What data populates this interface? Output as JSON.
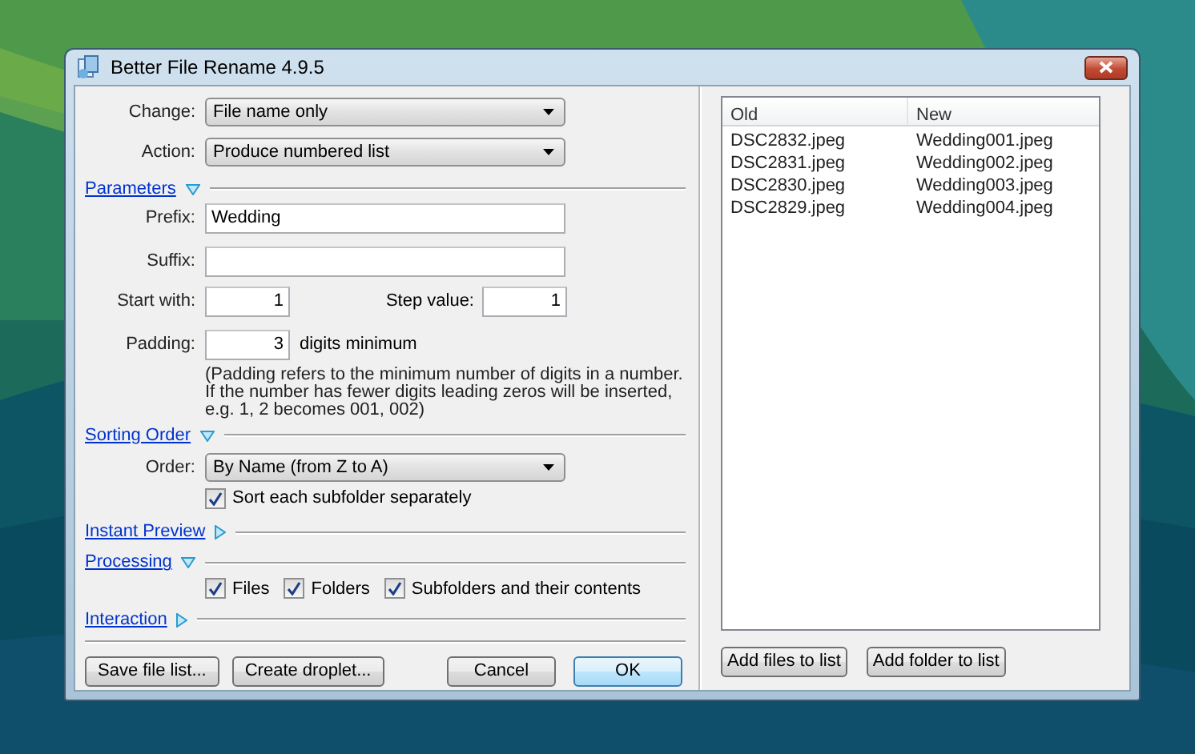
{
  "window": {
    "title": "Better File Rename 4.9.5"
  },
  "top_fields": [
    {
      "label": "Change:",
      "value": "File name only"
    },
    {
      "label": "Action:",
      "value": "Produce numbered list"
    }
  ],
  "sections": [
    {
      "kind": "parameters",
      "title": "Parameters",
      "expanded": true,
      "prefix": {
        "label": "Prefix:",
        "value": "Wedding"
      },
      "suffix": {
        "label": "Suffix:"
      },
      "start_with": {
        "label": "Start with:",
        "value": "1"
      },
      "step_value": {
        "label": "Step value:",
        "value": "1"
      },
      "padding": {
        "label": "Padding:",
        "value": "3",
        "unit": "digits minimum"
      },
      "note": "(Padding refers to the minimum number of digits in a number.\nIf the number has fewer digits leading zeros will be inserted,\ne.g. 1, 2 becomes 001, 002)"
    },
    {
      "kind": "sorting",
      "title": "Sorting Order",
      "expanded": true,
      "order": {
        "label": "Order:",
        "value": "By Name (from Z to A)"
      },
      "checkbox": {
        "label": "Sort each subfolder separately",
        "checked": true
      }
    },
    {
      "kind": "empty",
      "title": "Instant Preview",
      "expanded": false
    },
    {
      "kind": "processing",
      "title": "Processing",
      "expanded": true,
      "checkboxes": [
        {
          "label": "Files",
          "checked": true
        },
        {
          "label": "Folders",
          "checked": true
        },
        {
          "label": "Subfolders and their contents",
          "checked": true
        }
      ]
    },
    {
      "kind": "empty",
      "title": "Interaction",
      "expanded": false
    }
  ],
  "left_buttons": [
    {
      "label": "Save file list...",
      "default": false
    },
    {
      "label": "Create droplet...",
      "default": false
    }
  ],
  "dialog_buttons": [
    {
      "label": "Cancel",
      "default": false
    },
    {
      "label": "OK",
      "default": true
    }
  ],
  "file_list": {
    "columns": [
      "Old",
      "New"
    ],
    "rows": [
      [
        "DSC2832.jpeg",
        "Wedding001.jpeg"
      ],
      [
        "DSC2831.jpeg",
        "Wedding002.jpeg"
      ],
      [
        "DSC2830.jpeg",
        "Wedding003.jpeg"
      ],
      [
        "DSC2829.jpeg",
        "Wedding004.jpeg"
      ]
    ]
  },
  "list_buttons": [
    {
      "label": "Add files to list",
      "default": false
    },
    {
      "label": "Add folder to list",
      "default": false
    }
  ]
}
